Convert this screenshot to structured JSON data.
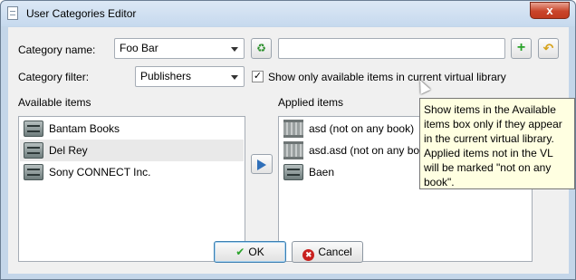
{
  "window": {
    "title": "User Categories Editor",
    "close_glyph": "x"
  },
  "category_name": {
    "label": "Category name:",
    "value": "Foo Bar",
    "text_value": ""
  },
  "category_filter": {
    "label": "Category filter:",
    "value": "Publishers"
  },
  "show_only": {
    "label": "Show only available items in current virtual library",
    "checked": true,
    "check_glyph": "✓"
  },
  "available": {
    "label": "Available items",
    "items": [
      {
        "label": "Bantam Books",
        "icon": "publisher-icon"
      },
      {
        "label": "Del Rey",
        "icon": "publisher-icon",
        "selected": true
      },
      {
        "label": "Sony CONNECT Inc.",
        "icon": "publisher-icon"
      }
    ]
  },
  "applied": {
    "label": "Applied items",
    "items": [
      {
        "label": "asd (not on any book)",
        "icon": "column-icon"
      },
      {
        "label": "asd.asd (not on any book)",
        "icon": "column-icon"
      },
      {
        "label": "Baen",
        "icon": "publisher-icon"
      }
    ]
  },
  "buttons": {
    "ok": "OK",
    "cancel": "Cancel",
    "ok_glyph": "✔",
    "cancel_glyph": "✖"
  },
  "tooltip": {
    "text": "Show items in the Available items box only if they appear in the current virtual library. Applied items not in the VL will be marked \"not on any book\"."
  },
  "colors": {
    "accent": "#2f6fb9",
    "add": "#2aa32a",
    "cancel": "#c8201e",
    "tooltip_bg": "#ffffe1"
  }
}
